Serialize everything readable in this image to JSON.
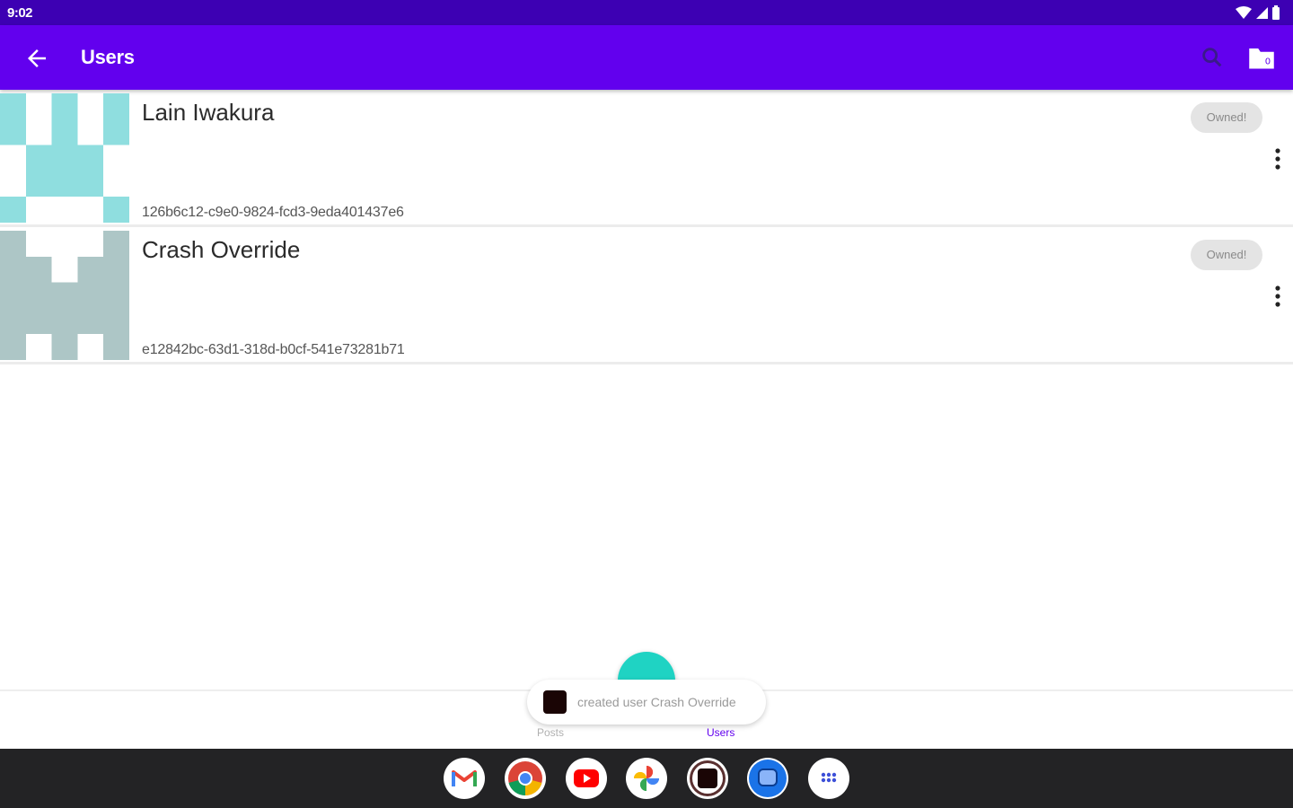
{
  "status_bar": {
    "time": "9:02",
    "wifi_icon": "wifi-icon",
    "signal_icon": "signal-icon",
    "battery_icon": "battery-icon"
  },
  "app_bar": {
    "title": "Users",
    "back_icon": "arrow-back-icon",
    "search_icon": "search-icon",
    "folder_icon": "folder-icon",
    "color": "#6200ee"
  },
  "users": [
    {
      "name": "Lain Iwakura",
      "id": "126b6c12-c9e0-9824-fcd3-9eda401437e6",
      "chip": "Owned!",
      "avatar_color": "#8fdedf"
    },
    {
      "name": "Crash Override",
      "id": "e12842bc-63d1-318d-b0cf-541e73281b71",
      "chip": "Owned!",
      "avatar_color": "#adc6c6"
    }
  ],
  "bottom_nav": {
    "items": [
      {
        "label": "Posts"
      },
      {
        "label": "Users"
      }
    ],
    "active": "Users"
  },
  "snackbar": {
    "message": "created user Crash Override"
  },
  "fab": {
    "color": "#1fd3c3"
  },
  "dock": {
    "apps": [
      "gmail-icon",
      "chrome-icon",
      "youtube-icon",
      "photos-icon",
      "camera-icon",
      "messages-icon",
      "app-drawer-icon"
    ]
  }
}
